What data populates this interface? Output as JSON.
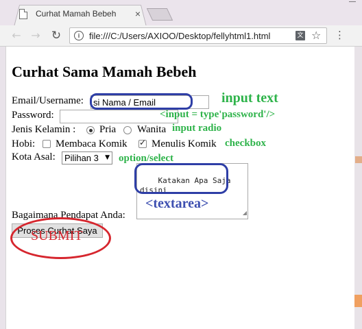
{
  "browser": {
    "tab_title": "Curhat Mamah Bebeh",
    "tab_close": "×",
    "url": "file:///C:/Users/AXIOO/Desktop/fellyhtml1.html",
    "back": "←",
    "forward": "→",
    "reload": "↻",
    "info": "i",
    "translate": "文",
    "star": "☆",
    "menu": "⋮",
    "minimize": "—"
  },
  "page": {
    "heading": "Curhat Sama Mamah Bebeh",
    "email_label": "Email/Username:",
    "email_value": "si Nama / Email",
    "password_label": "Password:",
    "password_value": "",
    "gender_label": "Jenis Kelamin :",
    "gender_options": [
      "Pria",
      "Wanita"
    ],
    "gender_selected": "Pria",
    "hobby_label": "Hobi:",
    "hobby_options": [
      {
        "label": "Membaca Komik",
        "checked": false
      },
      {
        "label": "Menulis Komik",
        "checked": true
      }
    ],
    "city_label": "Kota Asal:",
    "city_selected": "Pilihan 3",
    "opinion_label": "Bagaimana Pendapat Anda:",
    "textarea_value": "Katakan Apa Saja\ndisini",
    "submit_label": "Proses Curhat Saya"
  },
  "annotations": {
    "input_text": "input text",
    "input_password": "<input = type'password'/>",
    "input_radio": "input radio",
    "checkbox": "checkbox",
    "option_select": "option/select",
    "textarea": "<textarea>",
    "submit": "SUBMIT"
  },
  "colors": {
    "annotation_green": "#2eb34a",
    "annotation_blue": "#3d4fb0",
    "annotation_red": "#d6262e"
  }
}
